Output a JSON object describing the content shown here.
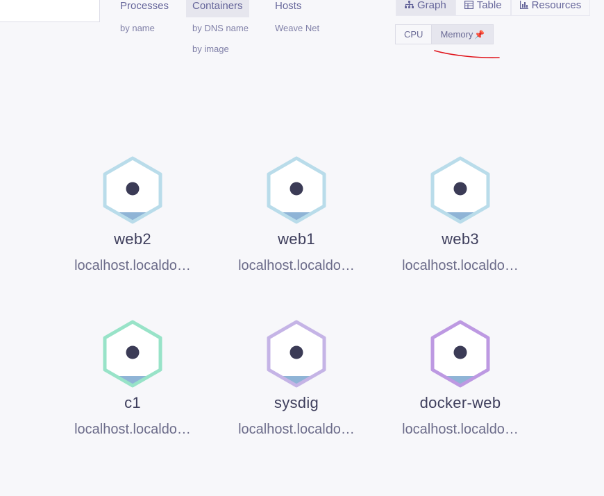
{
  "topology": [
    {
      "label": "Processes",
      "active": false,
      "subs": [
        "by name"
      ]
    },
    {
      "label": "Containers",
      "active": true,
      "subs": [
        "by DNS name",
        "by image"
      ]
    },
    {
      "label": "Hosts",
      "active": false,
      "subs": [
        "Weave Net"
      ]
    }
  ],
  "views": {
    "graph": "Graph",
    "table": "Table",
    "resources": "Resources",
    "active": "graph"
  },
  "metrics": {
    "cpu": "CPU",
    "memory": "Memory",
    "active": "memory",
    "pinned": "memory"
  },
  "nodes": [
    {
      "label": "web2",
      "sublabel": "localhost.localdo…",
      "color": "#b9dcea"
    },
    {
      "label": "web1",
      "sublabel": "localhost.localdo…",
      "color": "#b9dcea"
    },
    {
      "label": "web3",
      "sublabel": "localhost.localdo…",
      "color": "#b9dcea"
    },
    {
      "label": "c1",
      "sublabel": "localhost.localdo…",
      "color": "#98e3c8"
    },
    {
      "label": "sysdig",
      "sublabel": "localhost.localdo…",
      "color": "#c5b4e6"
    },
    {
      "label": "docker-web",
      "sublabel": "localhost.localdo…",
      "color": "#bd99e2"
    }
  ],
  "colors": {
    "annotation": "#e0141b",
    "node_center": "#3b3b56",
    "node_fill_bar": "#8fb4d6"
  }
}
